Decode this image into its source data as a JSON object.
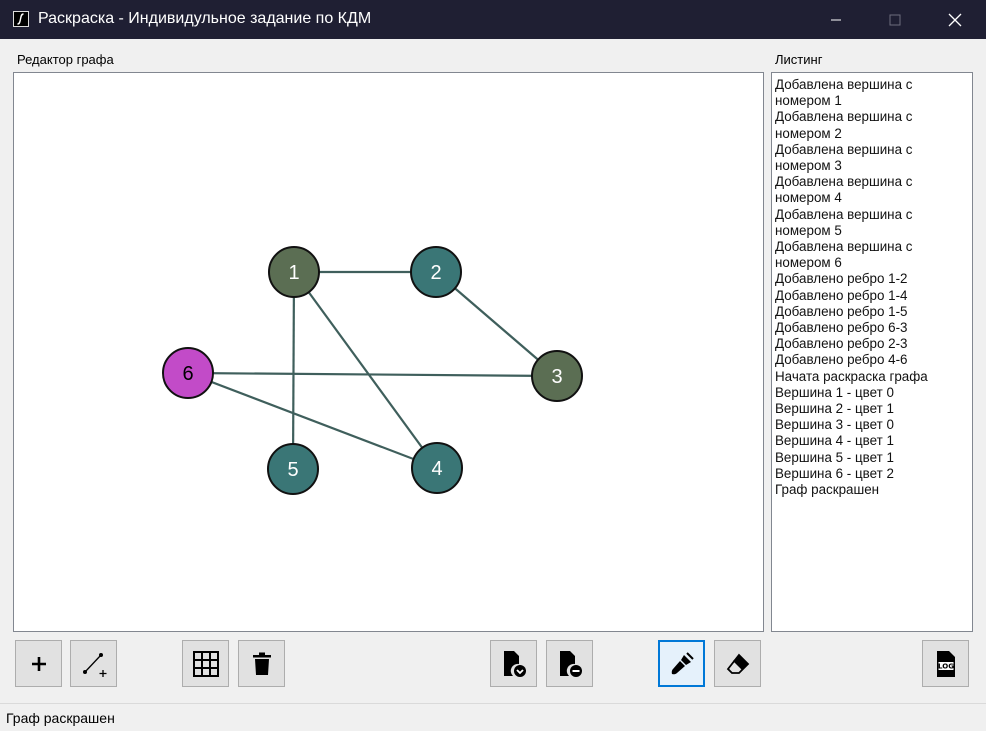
{
  "window": {
    "title": "Раскраска - Индивидульное задание по КДМ",
    "icon": "app-logo-icon",
    "controls": [
      "minimize-icon",
      "maximize-icon",
      "close-icon"
    ]
  },
  "editor": {
    "label": "Редактор графа"
  },
  "listing": {
    "label": "Листинг",
    "lines": [
      "Добавлена вершина с",
      "номером 1",
      "Добавлена вершина с",
      "номером 2",
      "Добавлена вершина с",
      "номером 3",
      "Добавлена вершина с",
      "номером 4",
      "Добавлена вершина с",
      "номером 5",
      "Добавлена вершина с",
      "номером 6",
      "Добавлено ребро 1-2",
      "Добавлено ребро 1-4",
      "Добавлено ребро 1-5",
      "Добавлено ребро 6-3",
      "Добавлено ребро 2-3",
      "Добавлено ребро 4-6",
      "Начата раскраска графа",
      "Вершина 1 - цвет 0",
      "Вершина 2 - цвет 1",
      "Вершина 3 - цвет 0",
      "Вершина 4 - цвет 1",
      "Вершина 5 - цвет 1",
      "Вершина 6 - цвет 2",
      "Граф раскрашен"
    ]
  },
  "graph": {
    "vertices": [
      {
        "id": "1",
        "color_index": 0
      },
      {
        "id": "2",
        "color_index": 1
      },
      {
        "id": "3",
        "color_index": 0
      },
      {
        "id": "4",
        "color_index": 1
      },
      {
        "id": "5",
        "color_index": 1
      },
      {
        "id": "6",
        "color_index": 2
      }
    ],
    "edges": [
      [
        "1",
        "2"
      ],
      [
        "1",
        "4"
      ],
      [
        "1",
        "5"
      ],
      [
        "6",
        "3"
      ],
      [
        "2",
        "3"
      ],
      [
        "4",
        "6"
      ]
    ],
    "palette": [
      "#5b6e53",
      "#3a7676",
      "#c24bc8"
    ],
    "edge_color": "#3f5f5c",
    "outline_color": "#111111",
    "label_color": "#ffffff"
  },
  "toolbar": {
    "buttons": [
      {
        "name": "add-vertex-button",
        "icon": "plus-icon"
      },
      {
        "name": "add-edge-button",
        "icon": "edge-add-icon"
      },
      {
        "name": "grid-button",
        "icon": "grid-icon"
      },
      {
        "name": "delete-button",
        "icon": "trash-icon"
      },
      {
        "name": "save-file-button",
        "icon": "file-download-icon"
      },
      {
        "name": "open-file-button",
        "icon": "file-upload-icon"
      },
      {
        "name": "paint-button",
        "icon": "brush-icon",
        "active": true
      },
      {
        "name": "erase-button",
        "icon": "eraser-icon"
      },
      {
        "name": "log-button",
        "icon": "log-file-icon"
      }
    ],
    "accent": "#0078d7"
  },
  "status": {
    "text": "Граф раскрашен"
  }
}
